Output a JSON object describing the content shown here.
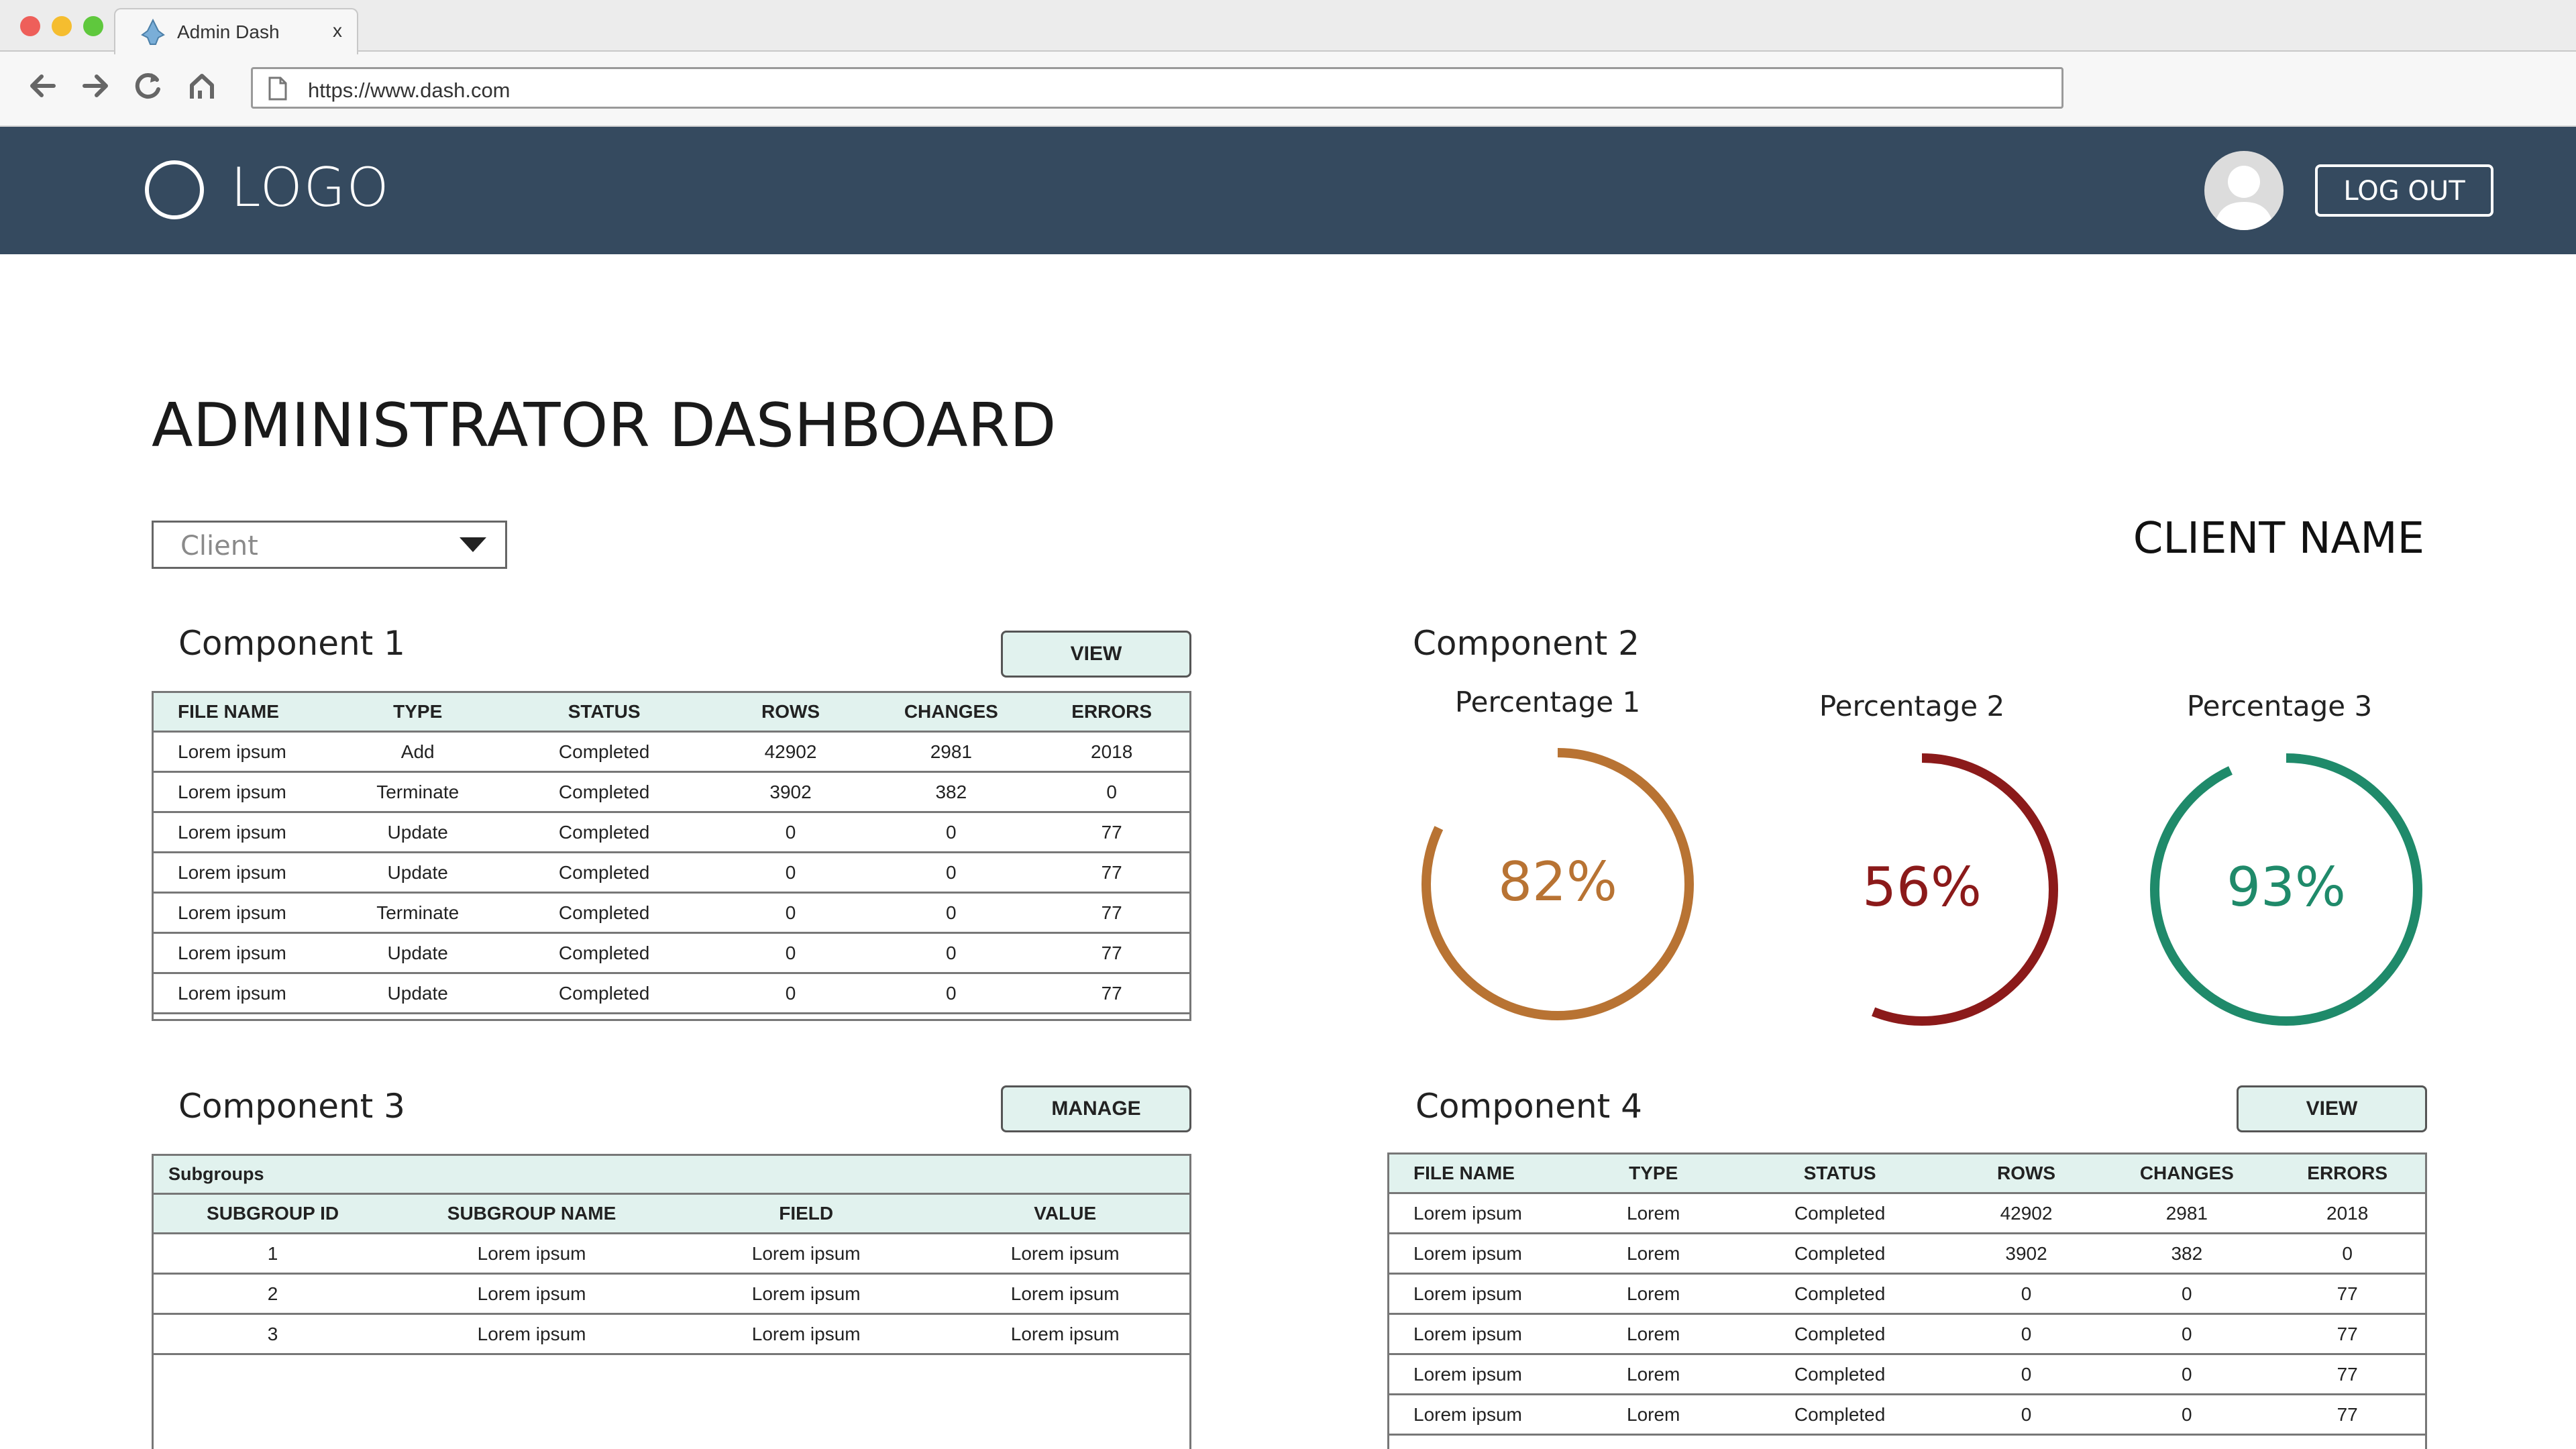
{
  "browser": {
    "tab_title": "Admin Dash",
    "tab_close": "x",
    "url": "https://www.dash.com",
    "icons": [
      "back-arrow-icon",
      "forward-arrow-icon",
      "reload-icon",
      "home-icon",
      "page-icon"
    ]
  },
  "header": {
    "logo_text": "LOGO",
    "logout_label": "LOG OUT",
    "bg_color": "#354a5f"
  },
  "page": {
    "title": "ADMINISTRATOR DASHBOARD",
    "client_select": {
      "value": "Client"
    },
    "client_name": "CLIENT NAME"
  },
  "component1": {
    "title": "Component 1",
    "button": "VIEW",
    "columns": [
      "FILE NAME",
      "TYPE",
      "STATUS",
      "ROWS",
      "CHANGES",
      "ERRORS"
    ],
    "rows": [
      [
        "Lorem ipsum",
        "Add",
        "Completed",
        "42902",
        "2981",
        "2018"
      ],
      [
        "Lorem ipsum",
        "Terminate",
        "Completed",
        "3902",
        "382",
        "0"
      ],
      [
        "Lorem ipsum",
        "Update",
        "Completed",
        "0",
        "0",
        "77"
      ],
      [
        "Lorem ipsum",
        "Update",
        "Completed",
        "0",
        "0",
        "77"
      ],
      [
        "Lorem ipsum",
        "Terminate",
        "Completed",
        "0",
        "0",
        "77"
      ],
      [
        "Lorem ipsum",
        "Update",
        "Completed",
        "0",
        "0",
        "77"
      ],
      [
        "Lorem ipsum",
        "Update",
        "Completed",
        "0",
        "0",
        "77"
      ]
    ]
  },
  "component2": {
    "title": "Component 2",
    "gauges": [
      {
        "label": "Percentage 1",
        "value_text": "82%",
        "fraction": 0.82,
        "color": "#b87333"
      },
      {
        "label": "Percentage 2",
        "value_text": "56%",
        "fraction": 0.56,
        "color": "#8b1a1a"
      },
      {
        "label": "Percentage 3",
        "value_text": "93%",
        "fraction": 0.93,
        "color": "#1f8a6a"
      }
    ]
  },
  "component3": {
    "title": "Component 3",
    "button": "MANAGE",
    "section_label": "Subgroups",
    "columns": [
      "SUBGROUP ID",
      "SUBGROUP NAME",
      "FIELD",
      "VALUE"
    ],
    "rows": [
      [
        "1",
        "Lorem ipsum",
        "Lorem ipsum",
        "Lorem ipsum"
      ],
      [
        "2",
        "Lorem ipsum",
        "Lorem ipsum",
        "Lorem ipsum"
      ],
      [
        "3",
        "Lorem ipsum",
        "Lorem ipsum",
        "Lorem ipsum"
      ]
    ]
  },
  "component4": {
    "title": "Component 4",
    "button": "VIEW",
    "columns": [
      "FILE NAME",
      "TYPE",
      "STATUS",
      "ROWS",
      "CHANGES",
      "ERRORS"
    ],
    "rows": [
      [
        "Lorem ipsum",
        "Lorem",
        "Completed",
        "42902",
        "2981",
        "2018"
      ],
      [
        "Lorem ipsum",
        "Lorem",
        "Completed",
        "3902",
        "382",
        "0"
      ],
      [
        "Lorem ipsum",
        "Lorem",
        "Completed",
        "0",
        "0",
        "77"
      ],
      [
        "Lorem ipsum",
        "Lorem",
        "Completed",
        "0",
        "0",
        "77"
      ],
      [
        "Lorem ipsum",
        "Lorem",
        "Completed",
        "0",
        "0",
        "77"
      ],
      [
        "Lorem ipsum",
        "Lorem",
        "Completed",
        "0",
        "0",
        "77"
      ]
    ]
  }
}
